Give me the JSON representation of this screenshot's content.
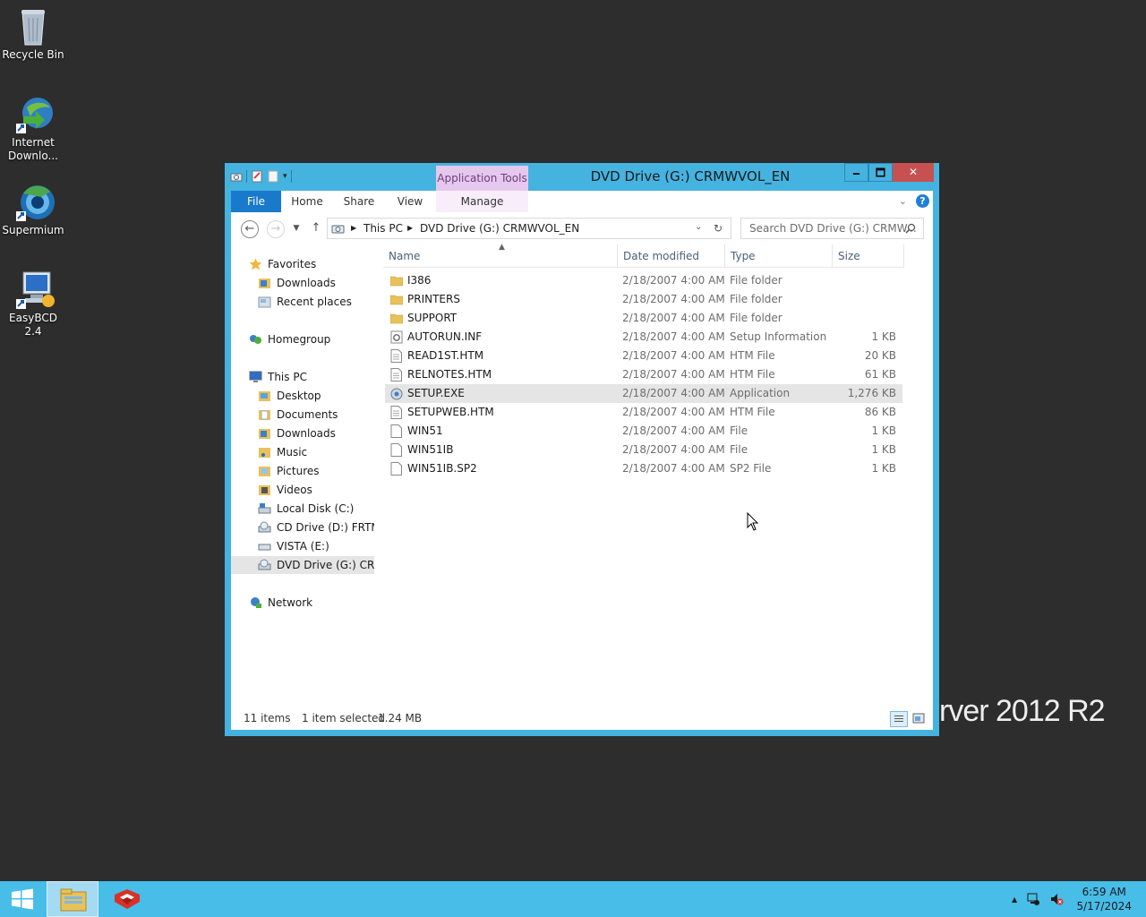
{
  "desktop": {
    "icons": [
      {
        "label": "Recycle Bin"
      },
      {
        "label": "Internet Downlo..."
      },
      {
        "label": "Supermium"
      },
      {
        "label": "EasyBCD 2.4"
      }
    ],
    "watermark": "rver 2012 R2"
  },
  "window": {
    "title": "DVD Drive (G:) CRMWVOL_EN",
    "contextual_tab_group": "Application Tools",
    "minimize_glyph": "🗕",
    "maximize_glyph": "🗖",
    "close_glyph": "✕",
    "tabs": {
      "file": "File",
      "home": "Home",
      "share": "Share",
      "view": "View",
      "manage": "Manage"
    },
    "help": "?"
  },
  "address": {
    "crumbs": [
      "This PC",
      "DVD Drive (G:) CRMWVOL_EN"
    ],
    "search_placeholder": "Search DVD Drive (G:) CRMW..."
  },
  "nav": {
    "favorites": "Favorites",
    "fav_items": [
      "Downloads",
      "Recent places"
    ],
    "homegroup": "Homegroup",
    "thispc": "This PC",
    "pc_items": [
      "Desktop",
      "Documents",
      "Downloads",
      "Music",
      "Pictures",
      "Videos",
      "Local Disk (C:)",
      "CD Drive (D:) FRTME",
      "VISTA (E:)",
      "DVD Drive (G:) CRM"
    ],
    "network": "Network"
  },
  "columns": {
    "name": "Name",
    "date": "Date modified",
    "type": "Type",
    "size": "Size"
  },
  "files": [
    {
      "name": "I386",
      "date": "2/18/2007 4:00 AM",
      "type": "File folder",
      "size": "",
      "icon": "folder-icon"
    },
    {
      "name": "PRINTERS",
      "date": "2/18/2007 4:00 AM",
      "type": "File folder",
      "size": "",
      "icon": "folder-icon"
    },
    {
      "name": "SUPPORT",
      "date": "2/18/2007 4:00 AM",
      "type": "File folder",
      "size": "",
      "icon": "folder-icon"
    },
    {
      "name": "AUTORUN.INF",
      "date": "2/18/2007 4:00 AM",
      "type": "Setup Information",
      "size": "1 KB",
      "icon": "setup-info-icon"
    },
    {
      "name": "READ1ST.HTM",
      "date": "2/18/2007 4:00 AM",
      "type": "HTM File",
      "size": "20 KB",
      "icon": "document-icon"
    },
    {
      "name": "RELNOTES.HTM",
      "date": "2/18/2007 4:00 AM",
      "type": "HTM File",
      "size": "61 KB",
      "icon": "document-icon"
    },
    {
      "name": "SETUP.EXE",
      "date": "2/18/2007 4:00 AM",
      "type": "Application",
      "size": "1,276 KB",
      "icon": "application-icon",
      "selected": true
    },
    {
      "name": "SETUPWEB.HTM",
      "date": "2/18/2007 4:00 AM",
      "type": "HTM File",
      "size": "86 KB",
      "icon": "document-icon"
    },
    {
      "name": "WIN51",
      "date": "2/18/2007 4:00 AM",
      "type": "File",
      "size": "1 KB",
      "icon": "file-icon"
    },
    {
      "name": "WIN51IB",
      "date": "2/18/2007 4:00 AM",
      "type": "File",
      "size": "1 KB",
      "icon": "file-icon"
    },
    {
      "name": "WIN51IB.SP2",
      "date": "2/18/2007 4:00 AM",
      "type": "SP2 File",
      "size": "1 KB",
      "icon": "file-icon"
    }
  ],
  "status": {
    "count": "11 items",
    "selection": "1 item selected",
    "size": "1.24 MB"
  },
  "taskbar": {
    "time": "6:59 AM",
    "date": "5/17/2024"
  },
  "colors": {
    "title_bar": "#45b3e0",
    "taskbar": "#47bde8",
    "file_tab": "#1979ca",
    "close_button": "#c75050",
    "folder": "#e8c15a"
  }
}
